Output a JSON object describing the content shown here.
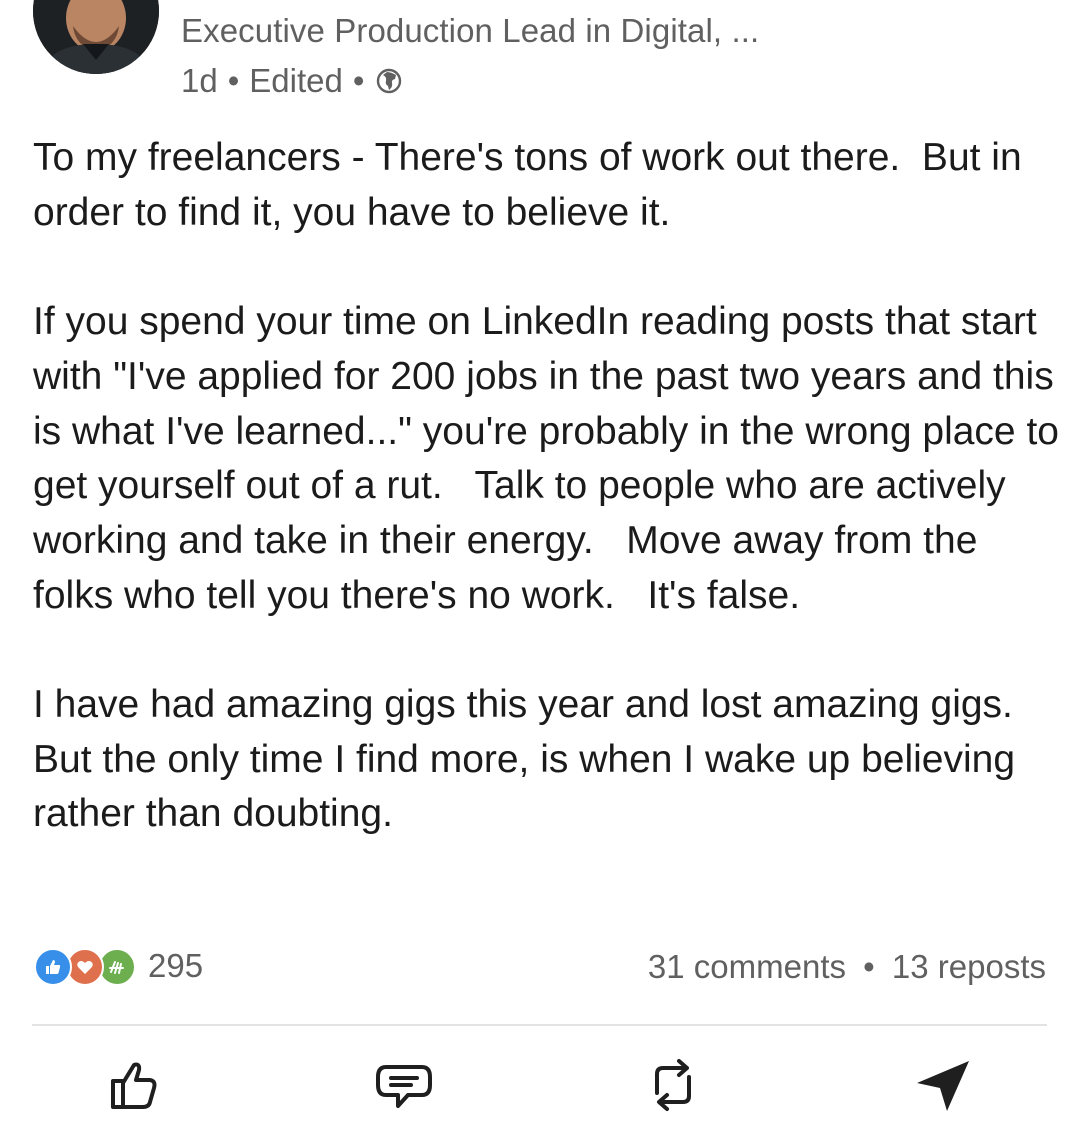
{
  "author": {
    "subtitle": "Executive Production Lead in Digital, ...",
    "age": "1d",
    "edited": "Edited",
    "separator": "•",
    "visibility_icon": "globe-icon"
  },
  "post": {
    "paragraphs": [
      "To my freelancers - There's tons of work out there.  But in order to find it, you have to believe it.",
      "If you spend your time on LinkedIn reading posts that start with \"I've applied for 200 jobs in the past two years and this is what I've learned...\" you're probably in the wrong place to get yourself out of a rut.   Talk to people who are actively working and take in their energy.   Move away from the folks who tell you there's no work.   It's false.",
      "I have had amazing gigs this year and lost amazing gigs.  But the only time I find more, is when I wake up believing rather than doubting."
    ]
  },
  "social": {
    "reaction_icons": [
      "like-icon",
      "love-icon",
      "celebrate-icon"
    ],
    "reaction_count": "295",
    "comments": "31 comments",
    "separator": "•",
    "reposts": "13 reposts"
  },
  "actions": [
    {
      "name": "like",
      "icon": "thumbs-up-icon"
    },
    {
      "name": "comment",
      "icon": "comment-icon"
    },
    {
      "name": "repost",
      "icon": "repost-icon"
    },
    {
      "name": "send",
      "icon": "send-icon"
    }
  ],
  "colors": {
    "like_blue": "#378fe9",
    "love_red": "#df704d",
    "celebrate_green": "#6dae4f",
    "secondary_text": "#606060",
    "primary_text": "#1b1b1b",
    "divider": "#e3e3e3"
  }
}
